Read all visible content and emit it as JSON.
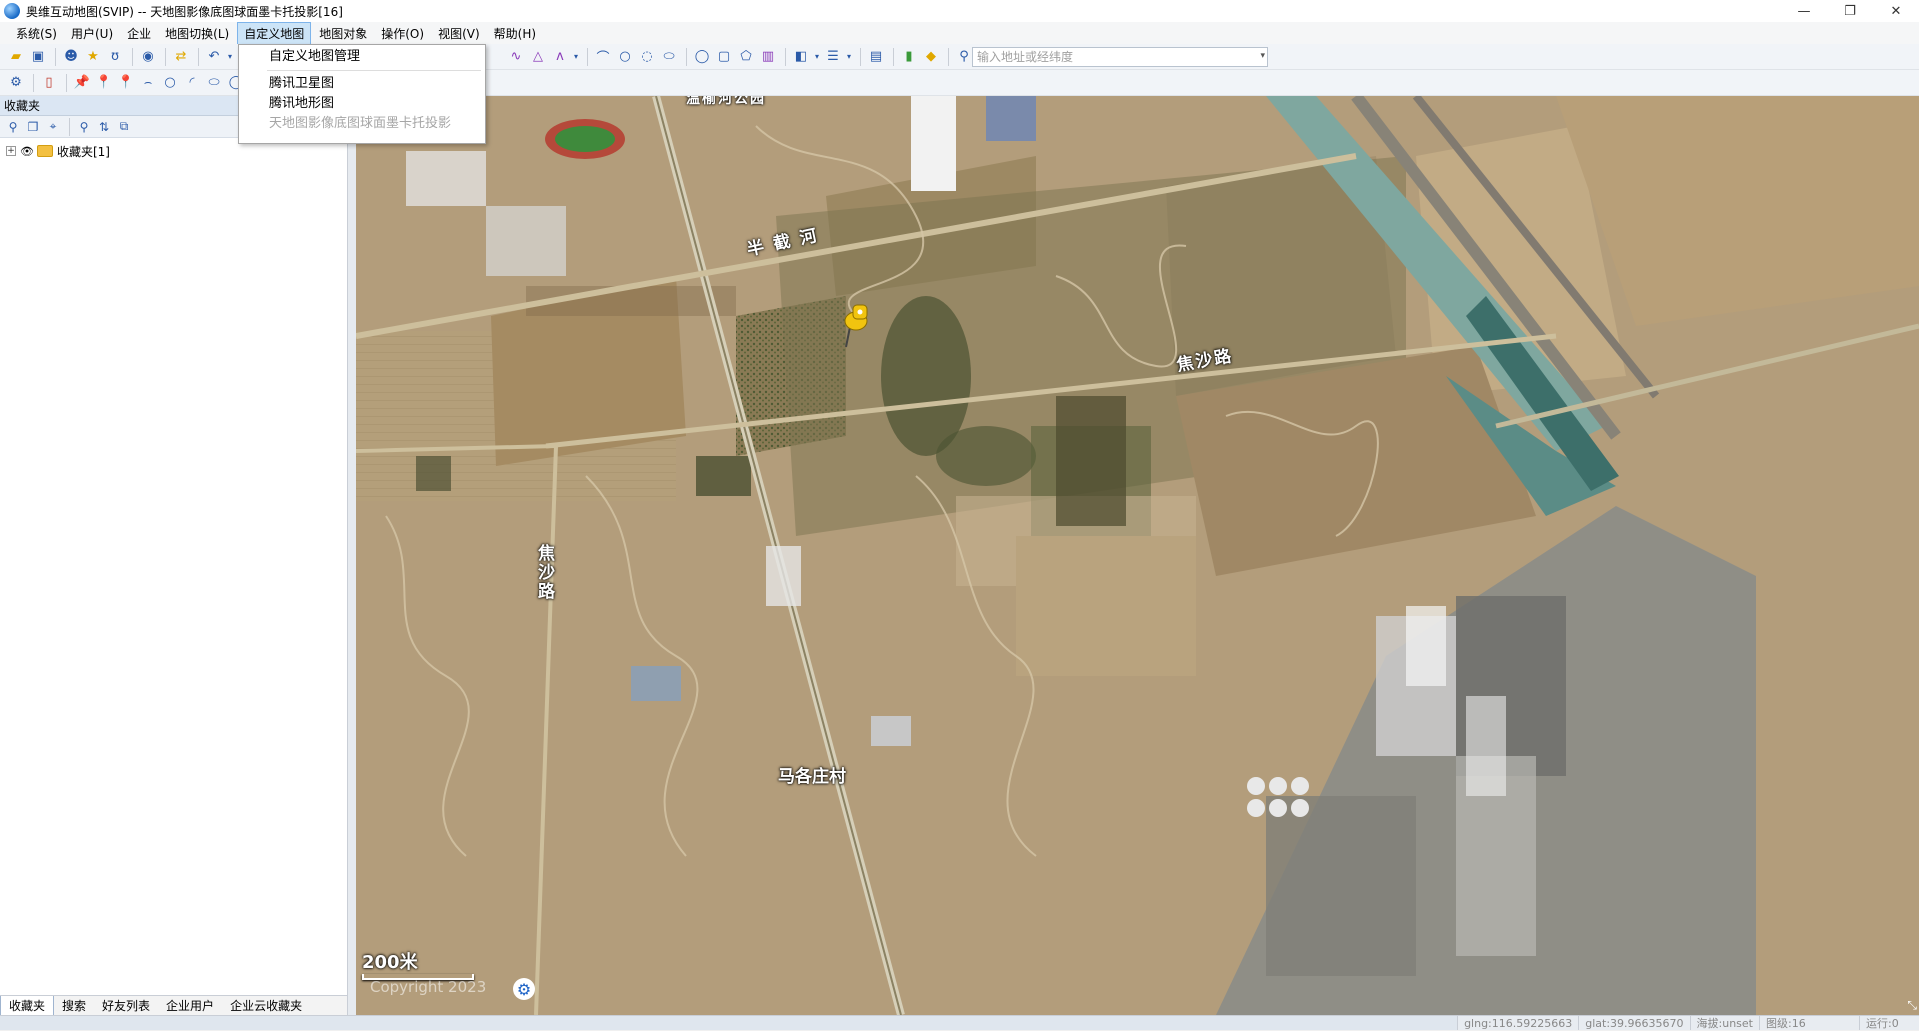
{
  "window": {
    "title": "奥维互动地图(SVIP) -- 天地图影像底图球面墨卡托投影[16]",
    "controls": [
      "—",
      "❐",
      "✕"
    ]
  },
  "menubar": {
    "items": [
      {
        "label": "系统(S)",
        "name": "menu-system"
      },
      {
        "label": "用户(U)",
        "name": "menu-user"
      },
      {
        "label": "企业",
        "name": "menu-enterprise"
      },
      {
        "label": "地图切换(L)",
        "name": "menu-map-switch"
      },
      {
        "label": "自定义地图",
        "name": "menu-custom-map"
      },
      {
        "label": "地图对象",
        "name": "menu-map-objects"
      },
      {
        "label": "操作(O)",
        "name": "menu-operations"
      },
      {
        "label": "视图(V)",
        "name": "menu-view"
      },
      {
        "label": "帮助(H)",
        "name": "menu-help"
      }
    ]
  },
  "dropdown": {
    "items": [
      {
        "label": "自定义地图管理",
        "disabled": false
      },
      {
        "label": "腾讯卫星图",
        "disabled": false
      },
      {
        "label": "腾讯地形图",
        "disabled": false
      },
      {
        "label": "天地图影像底图球面墨卡托投影",
        "disabled": true
      }
    ]
  },
  "toolbar": {
    "address_placeholder": "输入地址或经纬度"
  },
  "left_panel": {
    "title": "收藏夹",
    "tree": [
      {
        "label": "收藏夹[1]",
        "expander": "+"
      }
    ],
    "bottom_tabs": [
      "收藏夹",
      "搜索",
      "好友列表",
      "企业用户",
      "企业云收藏夹"
    ]
  },
  "map": {
    "labels": {
      "river": "半 截 河",
      "road_east": "焦沙路",
      "road_west": "焦沙路",
      "village": "马各庄村",
      "top_area": "温榆河公园"
    },
    "scale": "200米",
    "copyright": "Copyright 2023"
  },
  "statusbar": {
    "lng": "glng:116.59225663",
    "lat": "glat:39.96635670",
    "altitude": "海拔:unset",
    "level": "图级:16",
    "running": "运行:0"
  }
}
